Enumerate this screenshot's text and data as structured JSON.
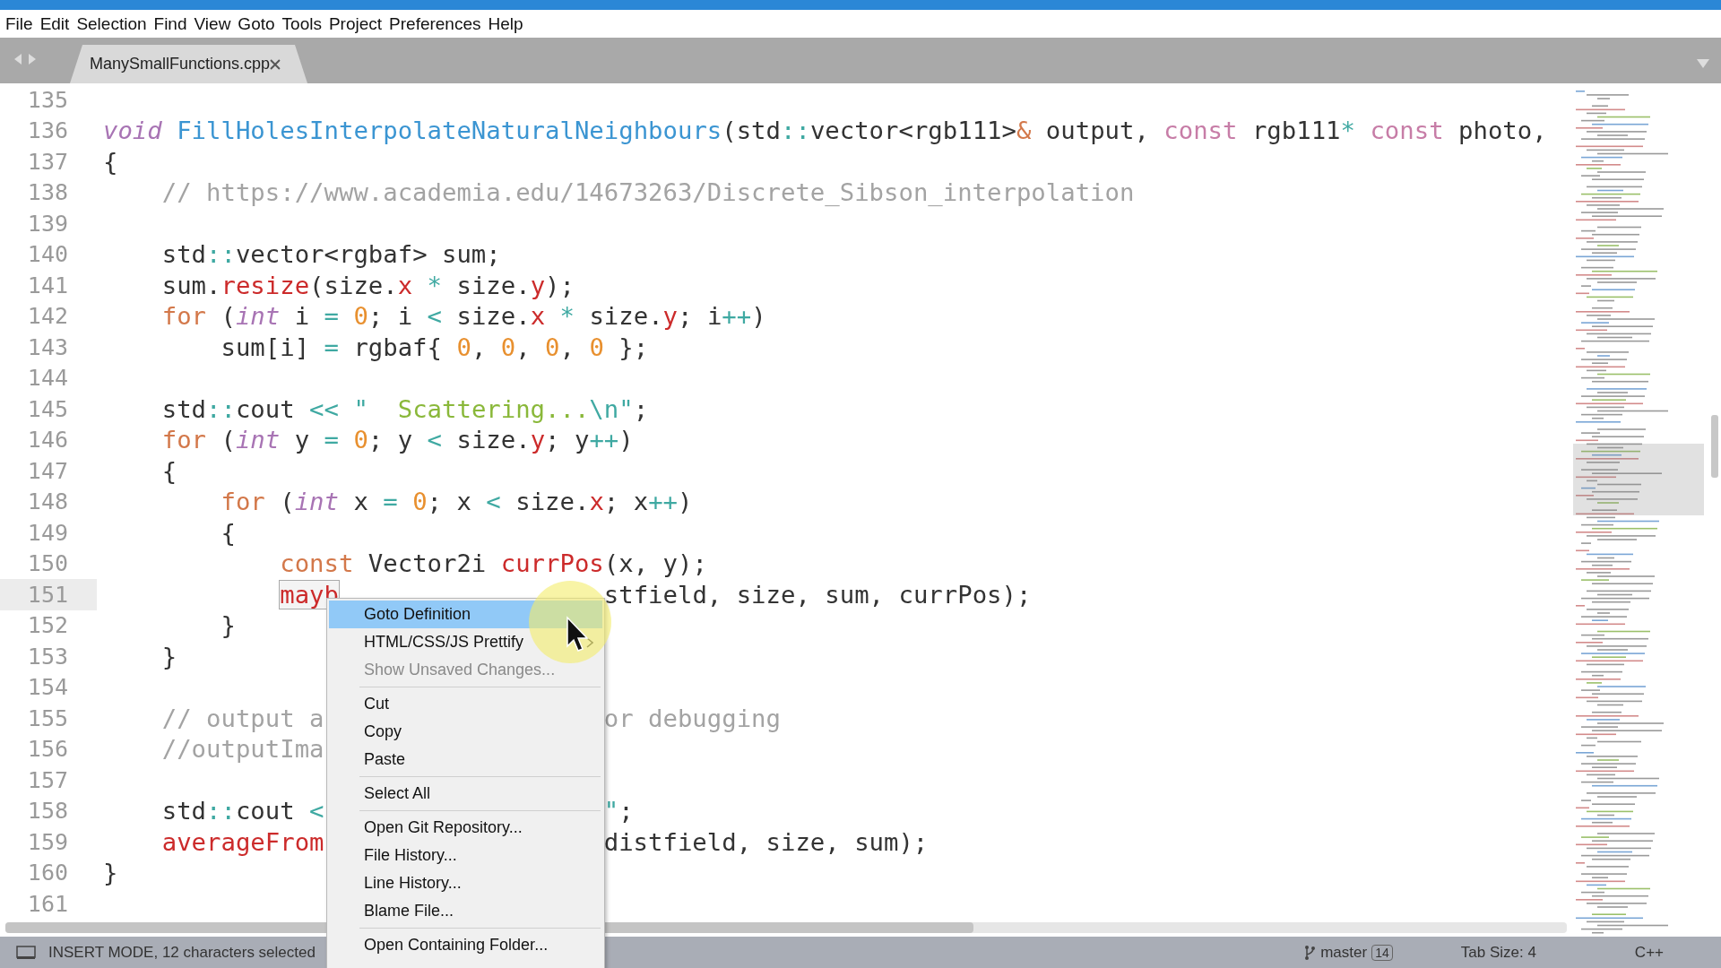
{
  "menu_bar": [
    "File",
    "Edit",
    "Selection",
    "Find",
    "View",
    "Goto",
    "Tools",
    "Project",
    "Preferences",
    "Help"
  ],
  "tabs": [
    {
      "label": "ManySmallFunctions.cpp",
      "selected": true
    }
  ],
  "editor": {
    "lines": [
      {
        "number": "135",
        "current": false
      },
      {
        "number": "136",
        "current": false,
        "tokens": [
          {
            "kind": "type",
            "text": "void"
          },
          {
            "kind": "fn",
            "text": " FillHolesInterpolateNaturalNeighbours"
          },
          {
            "kind": "p",
            "text": "(std"
          },
          {
            "kind": "op",
            "text": "::"
          },
          {
            "kind": "p",
            "text": "vector<rgb111>"
          },
          {
            "kind": "kw",
            "text": "&"
          },
          {
            "kind": "p",
            "text": " output, "
          },
          {
            "kind": "mod",
            "text": "const"
          },
          {
            "kind": "p",
            "text": " rgb111"
          },
          {
            "kind": "op",
            "text": "*"
          },
          {
            "kind": "mod",
            "text": " const"
          },
          {
            "kind": "p",
            "text": " photo,"
          }
        ]
      },
      {
        "number": "137",
        "current": false,
        "tokens": [
          {
            "kind": "p",
            "text": "{"
          }
        ]
      },
      {
        "number": "138",
        "current": false,
        "tokens": [
          {
            "kind": "c",
            "text": "    // https://www.academia.edu/14673263/Discrete_Sibson_interpolation"
          }
        ]
      },
      {
        "number": "139",
        "current": false
      },
      {
        "number": "140",
        "current": false,
        "tokens": [
          {
            "kind": "p",
            "text": "    std"
          },
          {
            "kind": "op",
            "text": "::"
          },
          {
            "kind": "p",
            "text": "vector<rgbaf> sum;"
          }
        ]
      },
      {
        "number": "141",
        "current": false,
        "tokens": [
          {
            "kind": "p",
            "text": "    sum."
          },
          {
            "kind": "m",
            "text": "resize"
          },
          {
            "kind": "p",
            "text": "(size."
          },
          {
            "kind": "m",
            "text": "x"
          },
          {
            "kind": "op",
            "text": " *"
          },
          {
            "kind": "p",
            "text": " size."
          },
          {
            "kind": "m",
            "text": "y"
          },
          {
            "kind": "p",
            "text": ");"
          }
        ]
      },
      {
        "number": "142",
        "current": false,
        "tokens": [
          {
            "kind": "kw",
            "text": "    for"
          },
          {
            "kind": "p",
            "text": " ("
          },
          {
            "kind": "type",
            "text": "int"
          },
          {
            "kind": "p",
            "text": " i "
          },
          {
            "kind": "op",
            "text": "="
          },
          {
            "kind": "n",
            "text": " 0"
          },
          {
            "kind": "p",
            "text": "; i "
          },
          {
            "kind": "op",
            "text": "<"
          },
          {
            "kind": "p",
            "text": " size."
          },
          {
            "kind": "m",
            "text": "x"
          },
          {
            "kind": "op",
            "text": " *"
          },
          {
            "kind": "p",
            "text": " size."
          },
          {
            "kind": "m",
            "text": "y"
          },
          {
            "kind": "p",
            "text": "; i"
          },
          {
            "kind": "op",
            "text": "++"
          },
          {
            "kind": "p",
            "text": ")"
          }
        ]
      },
      {
        "number": "143",
        "current": false,
        "tokens": [
          {
            "kind": "p",
            "text": "        sum[i] "
          },
          {
            "kind": "op",
            "text": "="
          },
          {
            "kind": "p",
            "text": " rgbaf{ "
          },
          {
            "kind": "n",
            "text": "0"
          },
          {
            "kind": "p",
            "text": ", "
          },
          {
            "kind": "n",
            "text": "0"
          },
          {
            "kind": "p",
            "text": ", "
          },
          {
            "kind": "n",
            "text": "0"
          },
          {
            "kind": "p",
            "text": ", "
          },
          {
            "kind": "n",
            "text": "0"
          },
          {
            "kind": "p",
            "text": " };"
          }
        ]
      },
      {
        "number": "144",
        "current": false
      },
      {
        "number": "145",
        "current": false,
        "tokens": [
          {
            "kind": "p",
            "text": "    std"
          },
          {
            "kind": "op",
            "text": "::"
          },
          {
            "kind": "p",
            "text": "cout "
          },
          {
            "kind": "op",
            "text": "<< \""
          },
          {
            "kind": "s",
            "text": "  Scattering..."
          },
          {
            "kind": "op",
            "text": "\\n\""
          },
          {
            "kind": "p",
            "text": ";"
          }
        ]
      },
      {
        "number": "146",
        "current": false,
        "tokens": [
          {
            "kind": "kw",
            "text": "    for"
          },
          {
            "kind": "p",
            "text": " ("
          },
          {
            "kind": "type",
            "text": "int"
          },
          {
            "kind": "p",
            "text": " y "
          },
          {
            "kind": "op",
            "text": "="
          },
          {
            "kind": "n",
            "text": " 0"
          },
          {
            "kind": "p",
            "text": "; y "
          },
          {
            "kind": "op",
            "text": "<"
          },
          {
            "kind": "p",
            "text": " size."
          },
          {
            "kind": "m",
            "text": "y"
          },
          {
            "kind": "p",
            "text": "; y"
          },
          {
            "kind": "op",
            "text": "++"
          },
          {
            "kind": "p",
            "text": ")"
          }
        ]
      },
      {
        "number": "147",
        "current": false,
        "tokens": [
          {
            "kind": "p",
            "text": "    {"
          }
        ]
      },
      {
        "number": "148",
        "current": false,
        "tokens": [
          {
            "kind": "kw",
            "text": "        for"
          },
          {
            "kind": "p",
            "text": " ("
          },
          {
            "kind": "type",
            "text": "int"
          },
          {
            "kind": "p",
            "text": " x "
          },
          {
            "kind": "op",
            "text": "="
          },
          {
            "kind": "n",
            "text": " 0"
          },
          {
            "kind": "p",
            "text": "; x "
          },
          {
            "kind": "op",
            "text": "<"
          },
          {
            "kind": "p",
            "text": " size."
          },
          {
            "kind": "m",
            "text": "x"
          },
          {
            "kind": "p",
            "text": "; x"
          },
          {
            "kind": "op",
            "text": "++"
          },
          {
            "kind": "p",
            "text": ")"
          }
        ]
      },
      {
        "number": "149",
        "current": false,
        "tokens": [
          {
            "kind": "p",
            "text": "        {"
          }
        ]
      },
      {
        "number": "150",
        "current": false,
        "tokens": [
          {
            "kind": "kw",
            "text": "            const"
          },
          {
            "kind": "p",
            "text": " Vector2i "
          },
          {
            "kind": "m",
            "text": "currPos"
          },
          {
            "kind": "p",
            "text": "(x, y);"
          }
        ]
      },
      {
        "number": "151",
        "current": true,
        "tokens": [
          {
            "kind": "sel",
            "text": "            mayb"
          }
        ],
        "right_tokens": [
          {
            "kind": "p",
            "text": "stfield, size, sum, currPos);"
          }
        ]
      },
      {
        "number": "152",
        "current": false,
        "tokens": [
          {
            "kind": "p",
            "text": "        }"
          }
        ]
      },
      {
        "number": "153",
        "current": false,
        "tokens": [
          {
            "kind": "p",
            "text": "    }"
          }
        ]
      },
      {
        "number": "154",
        "current": false
      },
      {
        "number": "155",
        "current": false,
        "tokens": [
          {
            "kind": "c",
            "text": "    // output a"
          }
        ],
        "right_tokens": [
          {
            "kind": "c",
            "text": "or debugging"
          }
        ]
      },
      {
        "number": "156",
        "current": false,
        "tokens": [
          {
            "kind": "c",
            "text": "    //outputIma"
          }
        ]
      },
      {
        "number": "157",
        "current": false
      },
      {
        "number": "158",
        "current": false,
        "tokens": [
          {
            "kind": "p",
            "text": "    std"
          },
          {
            "kind": "op",
            "text": "::"
          },
          {
            "kind": "p",
            "text": "cout "
          },
          {
            "kind": "op",
            "text": "<"
          }
        ],
        "right_tokens": [
          {
            "kind": "op",
            "text": "\""
          },
          {
            "kind": "p",
            "text": ";"
          }
        ]
      },
      {
        "number": "159",
        "current": false,
        "tokens": [
          {
            "kind": "m",
            "text": "    averageFrom"
          }
        ],
        "right_tokens": [
          {
            "kind": "p",
            "text": "distfield, size, sum);"
          }
        ]
      },
      {
        "number": "160",
        "current": false,
        "tokens": [
          {
            "kind": "p",
            "text": "}"
          }
        ]
      },
      {
        "number": "161",
        "current": false
      }
    ]
  },
  "context_menu": [
    {
      "kind": "item",
      "label": "Goto Definition",
      "selected": true,
      "disabled": false,
      "submenu": false
    },
    {
      "kind": "item",
      "label": "HTML/CSS/JS Prettify",
      "selected": false,
      "disabled": false,
      "submenu": true
    },
    {
      "kind": "item",
      "label": "Show Unsaved Changes...",
      "selected": false,
      "disabled": true,
      "submenu": false
    },
    {
      "kind": "separator"
    },
    {
      "kind": "item",
      "label": "Cut",
      "selected": false,
      "disabled": false,
      "submenu": false
    },
    {
      "kind": "item",
      "label": "Copy",
      "selected": false,
      "disabled": false,
      "submenu": false
    },
    {
      "kind": "item",
      "label": "Paste",
      "selected": false,
      "disabled": false,
      "submenu": false
    },
    {
      "kind": "separator"
    },
    {
      "kind": "item",
      "label": "Select All",
      "selected": false,
      "disabled": false,
      "submenu": false
    },
    {
      "kind": "separator"
    },
    {
      "kind": "item",
      "label": "Open Git Repository...",
      "selected": false,
      "disabled": false,
      "submenu": false
    },
    {
      "kind": "item",
      "label": "File History...",
      "selected": false,
      "disabled": false,
      "submenu": false
    },
    {
      "kind": "item",
      "label": "Line History...",
      "selected": false,
      "disabled": false,
      "submenu": false
    },
    {
      "kind": "item",
      "label": "Blame File...",
      "selected": false,
      "disabled": false,
      "submenu": false
    },
    {
      "kind": "separator"
    },
    {
      "kind": "item",
      "label": "Open Containing Folder...",
      "selected": false,
      "disabled": false,
      "submenu": false
    }
  ],
  "status_bar": {
    "mode": "INSERT MODE, 12 characters selected",
    "branch": "master",
    "changes": "14",
    "tab_size": "Tab Size: 4",
    "syntax": "C++"
  }
}
